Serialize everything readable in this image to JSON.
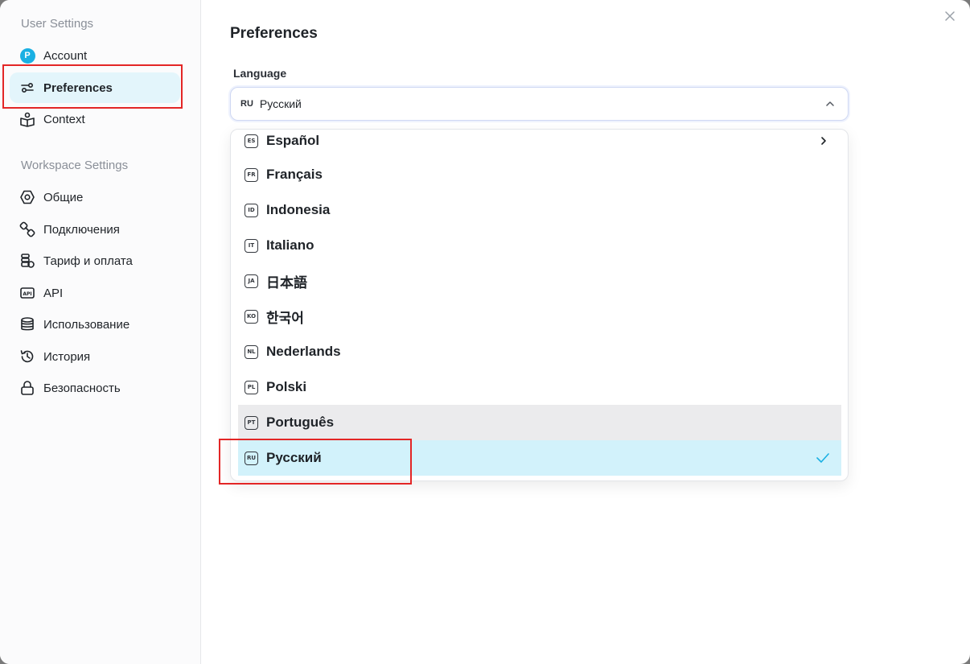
{
  "sidebar": {
    "user_section": "User Settings",
    "workspace_section": "Workspace Settings",
    "avatar_letter": "P",
    "user_items": [
      {
        "label": "Account",
        "icon": "avatar-icon"
      },
      {
        "label": "Preferences",
        "icon": "sliders-icon"
      },
      {
        "label": "Context",
        "icon": "book-person-icon"
      }
    ],
    "workspace_items": [
      {
        "label": "Общие",
        "icon": "hexagon-icon"
      },
      {
        "label": "Подключения",
        "icon": "plug-icon"
      },
      {
        "label": "Тариф и оплата",
        "icon": "coins-icon"
      },
      {
        "label": "API",
        "icon": "api-icon"
      },
      {
        "label": "Использование",
        "icon": "database-icon"
      },
      {
        "label": "История",
        "icon": "history-icon"
      },
      {
        "label": "Безопасность",
        "icon": "lock-icon"
      }
    ]
  },
  "main": {
    "title": "Preferences",
    "language_label": "Language",
    "select": {
      "code": "RU",
      "value": "Русский"
    },
    "options": [
      {
        "code": "ES",
        "label": "Español"
      },
      {
        "code": "FR",
        "label": "Français"
      },
      {
        "code": "ID",
        "label": "Indonesia"
      },
      {
        "code": "IT",
        "label": "Italiano"
      },
      {
        "code": "JA",
        "label": "日本語"
      },
      {
        "code": "KO",
        "label": "한국어"
      },
      {
        "code": "NL",
        "label": "Nederlands"
      },
      {
        "code": "PL",
        "label": "Polski"
      },
      {
        "code": "PT",
        "label": "Português"
      },
      {
        "code": "RU",
        "label": "Русский"
      }
    ]
  },
  "colors": {
    "accent": "#1ab0e3",
    "active_bg": "#e3f5fb",
    "selected_bg": "#d2f2fb",
    "hover_bg": "#ebebed",
    "highlight": "#e32626"
  }
}
